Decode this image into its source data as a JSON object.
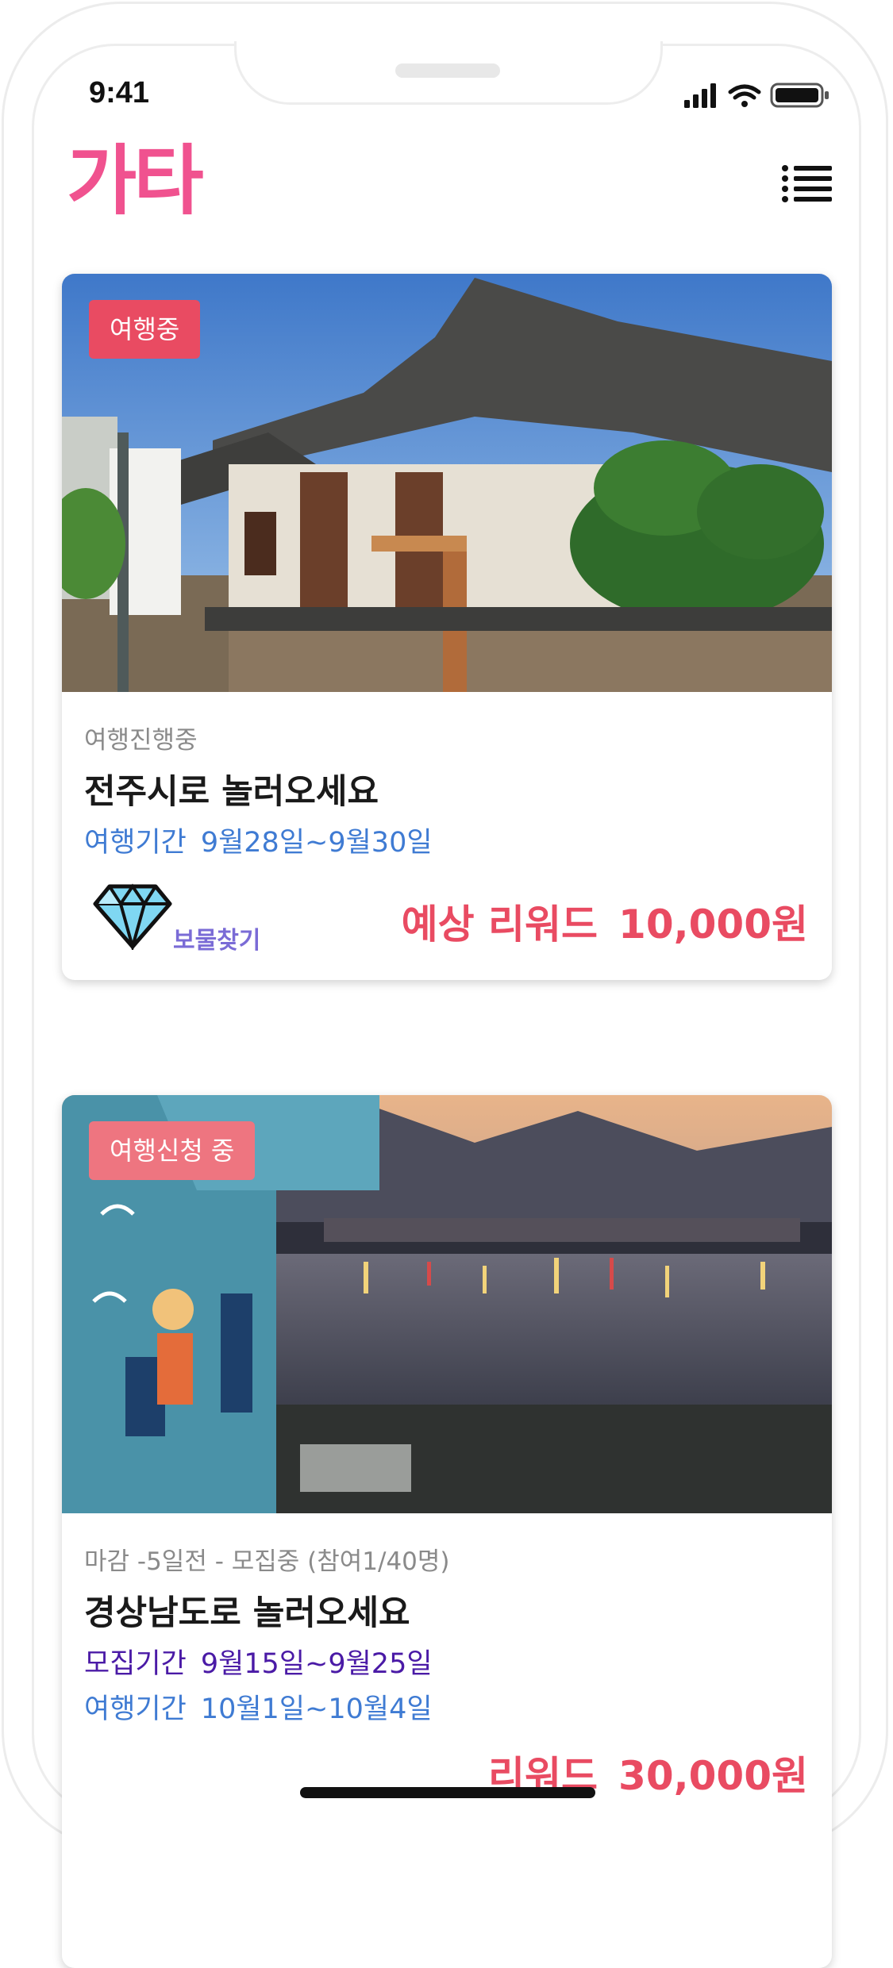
{
  "status_bar": {
    "time": "9:41"
  },
  "header": {
    "logo": "가타",
    "menu_icon": "list-menu-icon"
  },
  "cards": [
    {
      "badge": "여행중",
      "status": "여행진행중",
      "title": "전주시로 놀러오세요",
      "travel_period_label": "여행기간",
      "travel_period_value": "9월28일~9월30일",
      "tag_icon": "diamond-icon",
      "tag_label": "보물찾기",
      "reward_label": "예상 리워드",
      "reward_value": "10,000원",
      "image": "hanok-village-photo"
    },
    {
      "badge": "여행신청 중",
      "status": "마감 -5일전 - 모집중 (참여1/40명)",
      "title": "경상남도로 놀러오세요",
      "recruit_period_label": "모집기간",
      "recruit_period_value": "9월15일~9월25일",
      "travel_period_label": "여행기간",
      "travel_period_value": "10월1일~10월4일",
      "reward_label": "리워드",
      "reward_value": "30,000원",
      "image": "harbor-night-photo"
    }
  ],
  "colors": {
    "brand": "#f0528f",
    "accent": "#e94b62",
    "badge2": "#ee7580",
    "period": "#3f7bd3",
    "recruit": "#4a1aa6",
    "tag": "#7a6bd6"
  }
}
